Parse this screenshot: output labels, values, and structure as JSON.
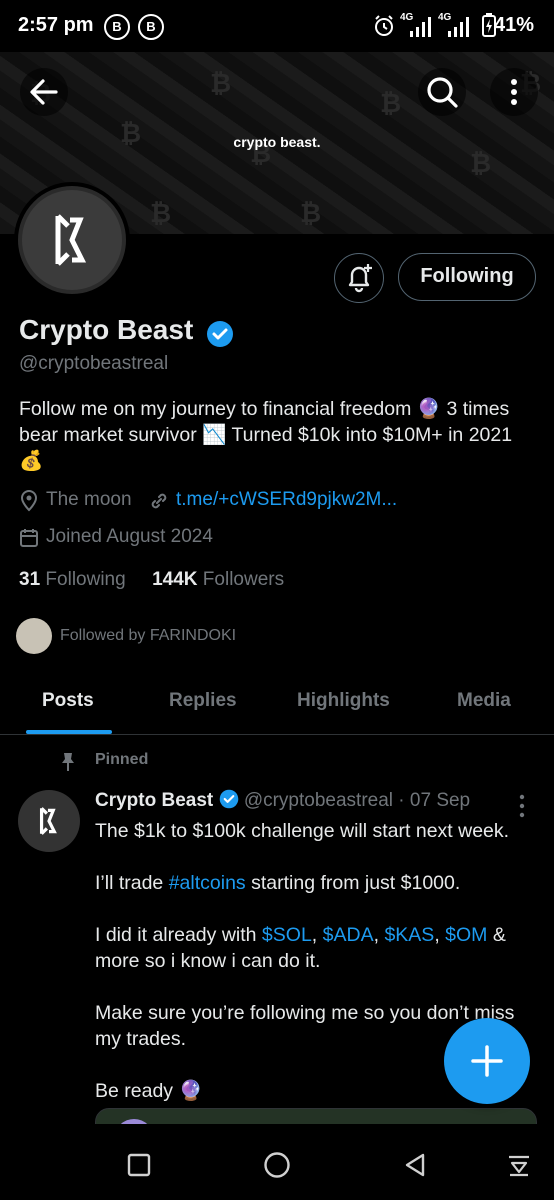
{
  "status_bar": {
    "time": "2:57 pm",
    "notif_icons": [
      "B",
      "B"
    ],
    "network_left": "4G",
    "network_right": "4G",
    "battery": "41%"
  },
  "banner": {
    "text": "crypto beast."
  },
  "header_actions": {
    "back_icon": "arrow-left-icon",
    "search_icon": "search-icon",
    "more_icon": "more-vertical-icon"
  },
  "profile": {
    "name": "Crypto Beast",
    "handle": "@cryptobeastreal",
    "follow_button": "Following",
    "bio_line1": "Follow me on my journey to financial freedom 🔮 3 times",
    "bio_line2": "bear market survivor 📉 Turned $10k into $10M+ in 2021",
    "bio_line3": "💰",
    "location": "The moon",
    "link": "t.me/+cWSERd9pjkw2M...",
    "joined": "Joined August 2024",
    "following_count": "31",
    "following_label": "Following",
    "followers_count": "144K",
    "followers_label": "Followers",
    "followed_by": "Followed by FARINDOKI"
  },
  "tabs": [
    {
      "label": "Posts",
      "active": true
    },
    {
      "label": "Replies",
      "active": false
    },
    {
      "label": "Highlights",
      "active": false
    },
    {
      "label": "Media",
      "active": false
    }
  ],
  "post": {
    "pinned_label": "Pinned",
    "author": "Crypto Beast",
    "handle": "@cryptobeastreal",
    "dot": "·",
    "date": "07 Sep",
    "line1": "The $1k to $100k challenge will start next week.",
    "p2_pre": "I’ll trade ",
    "p2_tag": "#altcoins",
    "p2_post": " starting from just $1000.",
    "p3_pre": "I did it already with ",
    "p3_t1": "$SOL",
    "p3_s1": ", ",
    "p3_t2": "$ADA",
    "p3_s2": ", ",
    "p3_t3": "$KAS",
    "p3_s3": ", ",
    "p3_t4": "$OM",
    "p3_post": " & more so i know i can do it.",
    "p4": "Make sure you’re following me so you don’t miss my trades.",
    "p5": "Be ready 🔮"
  },
  "colors": {
    "accent": "#1d9bf0",
    "muted": "#71767b",
    "text": "#e7e9ea",
    "background": "#000000"
  },
  "nav_bar": {
    "recent_icon": "square-icon",
    "home_icon": "circle-icon",
    "back_icon": "triangle-back-icon",
    "extra_icon": "notification-shade-icon"
  }
}
